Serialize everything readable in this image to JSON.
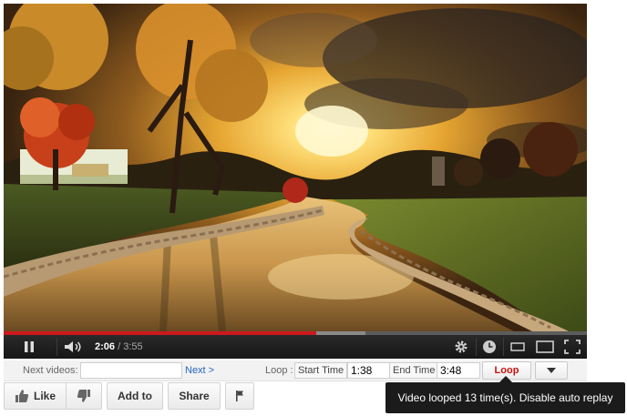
{
  "player": {
    "current_time": "2:06",
    "total_time": "3:55",
    "progress_fraction": 0.536,
    "buffered_fraction": 0.62
  },
  "loop_bar": {
    "next_videos_label": "Next videos:",
    "next_videos_value": "",
    "next_link": "Next >",
    "loop_label": "Loop :",
    "start_time_label": "Start Time",
    "start_time_value": "1:38",
    "end_time_label": "End Time",
    "end_time_value": "3:48",
    "loop_button": "Loop"
  },
  "actions": {
    "like": "Like",
    "add_to": "Add to",
    "share": "Share"
  },
  "tooltip": {
    "text": "Video looped 13 time(s). Disable auto replay"
  },
  "icons": {
    "pause": "pause-icon",
    "volume": "volume-icon",
    "settings": "gear-icon",
    "watch_later": "clock-icon",
    "small_player": "small-player-icon",
    "large_player": "large-player-icon",
    "fullscreen": "fullscreen-icon",
    "like": "thumbs-up-icon",
    "dislike": "thumbs-down-icon",
    "flag": "flag-icon",
    "dropdown": "chevron-down-icon"
  },
  "colors": {
    "progress_played": "#cc181e",
    "loop_button_text": "#cc1010",
    "link": "#2565c6",
    "tooltip_bg": "#1b1b1b"
  }
}
